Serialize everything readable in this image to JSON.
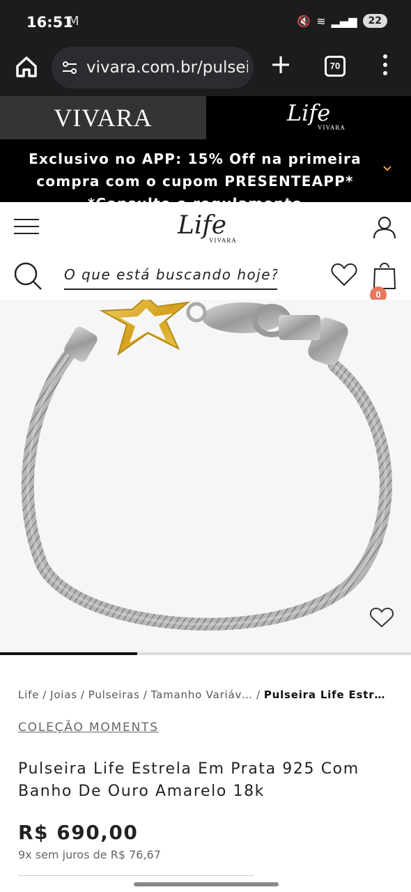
{
  "status_bar": {
    "time": "16:51",
    "mail_icon": "gmail-icon",
    "battery": "22"
  },
  "browser": {
    "url": "vivara.com.br/pulseir",
    "tabs_count": "70",
    "home_icon": "home-icon",
    "plus_icon": "+"
  },
  "brand_bar": {
    "left_logo": "VIVARA",
    "right_logo_script": "Life",
    "right_logo_sub": "VIVARA"
  },
  "promo": {
    "text": "Exclusivo no APP: 15% Off na primeira compra com o cupom PRESENTEAPP* *Consulte o regulamento"
  },
  "header": {
    "logo_script": "Life",
    "logo_sub": "VIVARA",
    "search_placeholder": "O que está buscando hoje?",
    "cart_count": "0"
  },
  "breadcrumb": {
    "items": [
      "Life",
      "Joias",
      "Pulseiras",
      "Tamanho Variáv…"
    ],
    "current": "Pulseira Life Estr…"
  },
  "product": {
    "collection": "COLEÇÃO MOMENTS",
    "title": "Pulseira Life Estrela Em Prata 925 Com Banho De Ouro Amarelo 18k",
    "price": "R$ 690,00",
    "installments": "9x sem juros de R$ 76,67",
    "image_alt_colors": {
      "silver": "#b8b8b8",
      "gold": "#e2b93b"
    }
  },
  "carousel": {
    "active_index": 1,
    "total": 3
  },
  "colors": {
    "dark_bar": "#1c1c1e",
    "promo_bg": "#000000",
    "accent_badge": "#e8775c",
    "chevron": "#e8a24a"
  }
}
